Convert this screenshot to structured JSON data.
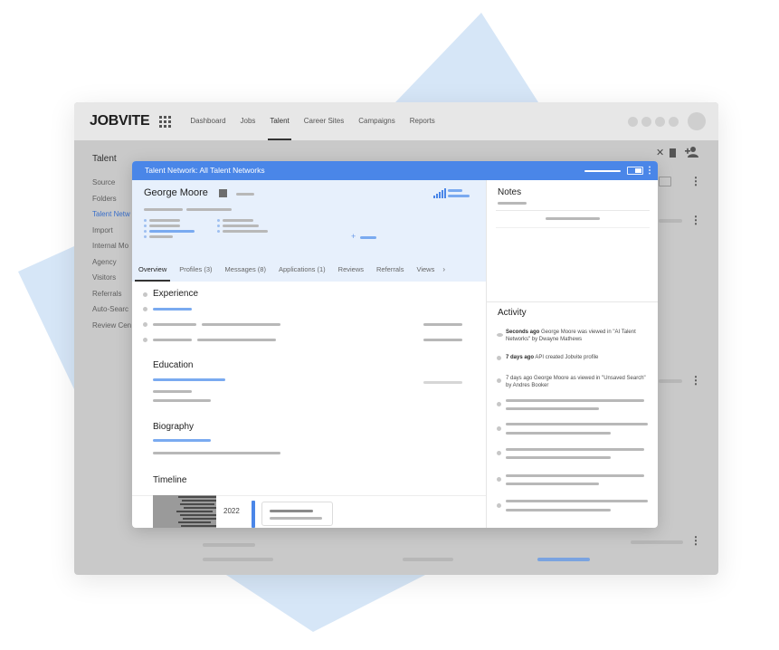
{
  "app": {
    "brand": "JOBVITE",
    "nav": [
      "Dashboard",
      "Jobs",
      "Talent",
      "Career Sites",
      "Campaigns",
      "Reports"
    ],
    "active_nav": "Talent"
  },
  "sidebar": {
    "title": "Talent",
    "items": [
      "Source",
      "Folders",
      "Talent Netw",
      "Import",
      "Internal Mo",
      "Agency",
      "Visitors",
      "Referrals",
      "Auto-Searc",
      "Review Cen"
    ],
    "active_item": "Talent Netw"
  },
  "modal": {
    "title": "Talent Network: All Talent Networks",
    "candidate_name": "George Moore",
    "tabs": [
      "Overview",
      "Profiles (3)",
      "Messages (8)",
      "Applications (1)",
      "Reviews",
      "Referrals",
      "Views"
    ],
    "active_tab": "Overview",
    "sections": {
      "experience": "Experience",
      "education": "Education",
      "biography": "Biography",
      "timeline": "Timeline"
    },
    "timeline_year": "2022",
    "notes_title": "Notes",
    "activity_title": "Activity",
    "activity": [
      {
        "time": "Seconds ago",
        "text": "George Moore was viewed in \"AI Talent Networks\" by Dwayne Mathews"
      },
      {
        "time": "7 days ago",
        "text": "API created Jobvite profile"
      },
      {
        "time": "",
        "text": "7 days ago George Moore as viewed in \"Unsaved Search\" by Andres Booker"
      }
    ]
  },
  "colors": {
    "accent": "#4a86e8",
    "profile_bg": "#e7f0fc",
    "backdrop_shape": "#d6e6f7"
  }
}
